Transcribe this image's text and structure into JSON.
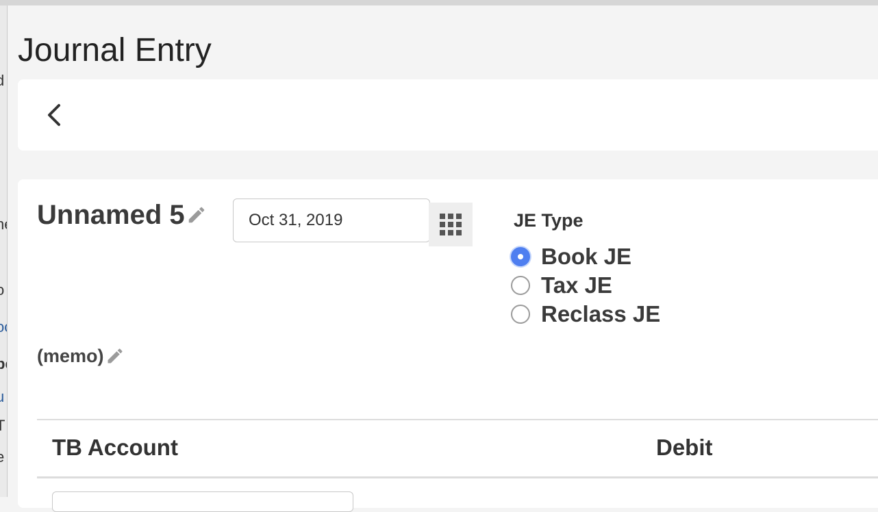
{
  "background_panel": {
    "edge_fragments": [
      "d",
      "he",
      "o",
      "oc",
      "be",
      "u",
      "T",
      "e"
    ]
  },
  "page": {
    "title": "Journal Entry"
  },
  "toolbar": {
    "back_icon": "chevron-left-icon"
  },
  "entry": {
    "name": "Unnamed 5",
    "date": "Oct 31, 2019",
    "memo": "(memo)",
    "edit_icon": "pencil-icon",
    "calendar_icon": "calendar-grid-icon"
  },
  "je_type": {
    "label": "JE Type",
    "options": [
      {
        "label": "Book JE",
        "selected": true
      },
      {
        "label": "Tax JE",
        "selected": false
      },
      {
        "label": "Reclass JE",
        "selected": false
      }
    ]
  },
  "table": {
    "headers": [
      "TB Account",
      "Debit"
    ]
  },
  "colors": {
    "radio_selected": "#4f7ff0",
    "link_fragment": "#2a5b9b"
  }
}
